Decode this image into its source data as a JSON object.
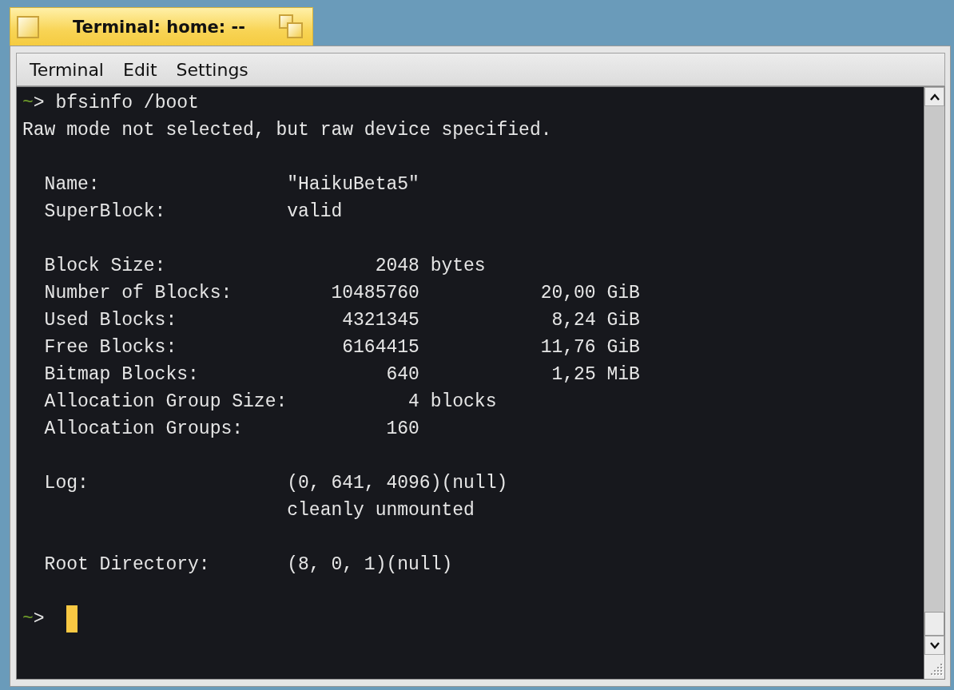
{
  "window": {
    "title": "Terminal: home: --"
  },
  "menu": [
    {
      "label": "Terminal"
    },
    {
      "label": "Edit"
    },
    {
      "label": "Settings"
    }
  ],
  "terminal": {
    "lines": [
      {
        "kind": "command",
        "cwd": "~",
        "symbol": ">",
        "text": "bfsinfo /boot"
      },
      {
        "kind": "output",
        "text": "Raw mode not selected, but raw device specified."
      },
      {
        "kind": "blank"
      },
      {
        "kind": "field",
        "label": "Name:",
        "value": "\"HaikuBeta5\""
      },
      {
        "kind": "field",
        "label": "SuperBlock:",
        "value": "valid"
      },
      {
        "kind": "blank"
      },
      {
        "kind": "stat",
        "label": "Block Size:",
        "count": "2048",
        "unit": "bytes"
      },
      {
        "kind": "stat",
        "label": "Number of Blocks:",
        "count": "10485760",
        "size": "20,00 GiB"
      },
      {
        "kind": "stat",
        "label": "Used Blocks:",
        "count": "4321345",
        "size": "8,24 GiB"
      },
      {
        "kind": "stat",
        "label": "Free Blocks:",
        "count": "6164415",
        "size": "11,76 GiB"
      },
      {
        "kind": "stat",
        "label": "Bitmap Blocks:",
        "count": "640",
        "size": "1,25 MiB"
      },
      {
        "kind": "stat",
        "label": "Allocation Group Size:",
        "count": "4",
        "unit": "blocks"
      },
      {
        "kind": "stat",
        "label": "Allocation Groups:",
        "count": "160"
      },
      {
        "kind": "blank"
      },
      {
        "kind": "field",
        "label": "Log:",
        "value": "(0, 641, 4096)(null)"
      },
      {
        "kind": "continuation",
        "value": "cleanly unmounted"
      },
      {
        "kind": "blank"
      },
      {
        "kind": "field",
        "label": "Root Directory:",
        "value": "(8, 0, 1)(null)"
      },
      {
        "kind": "blank"
      },
      {
        "kind": "prompt",
        "cwd": "~",
        "symbol": ">"
      }
    ]
  }
}
